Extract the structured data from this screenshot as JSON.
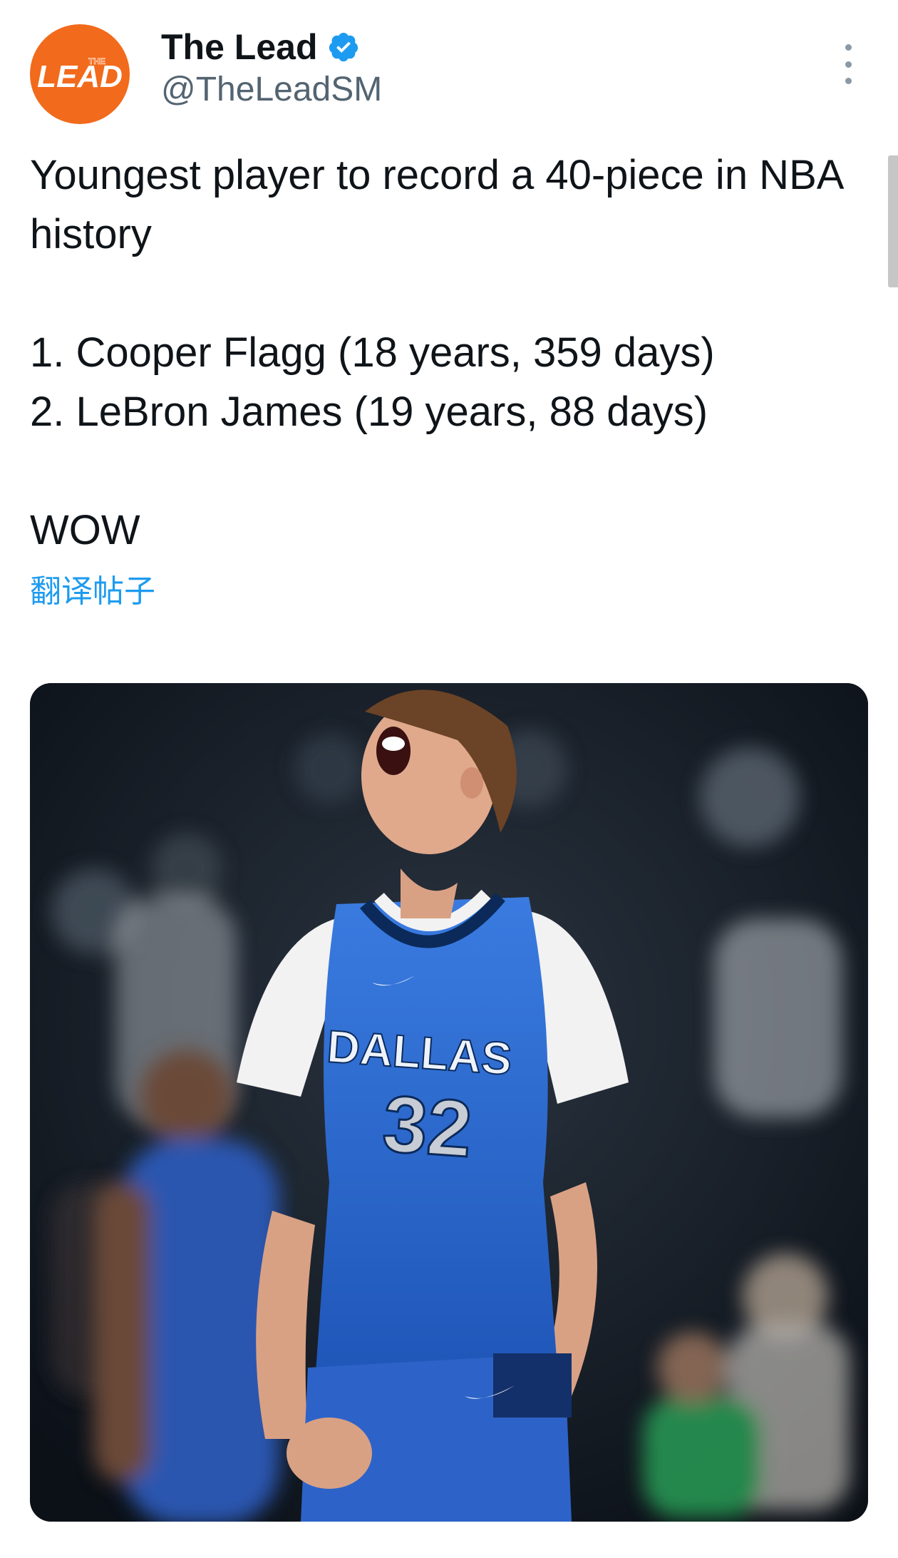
{
  "author": {
    "display_name": "The Lead",
    "handle": "@TheLeadSM",
    "avatar_icon": "the-lead-logo-icon",
    "avatar_color": "#f26a1b",
    "verified": true,
    "verified_color": "#1d9bf0"
  },
  "tweet": {
    "lines": [
      "Youngest player to record a 40-piece in NBA history",
      "",
      "1. Cooper Flagg (18 years, 359 days)",
      "2. LeBron James (19 years, 88 days)",
      "",
      "WOW"
    ],
    "translate_label": "翻译帖子"
  },
  "media": {
    "jersey_team": "DALLAS",
    "jersey_number": "32",
    "jersey_color": "#2f6fd6"
  },
  "logo_text": {
    "main": "LEAD",
    "small": "THE"
  }
}
